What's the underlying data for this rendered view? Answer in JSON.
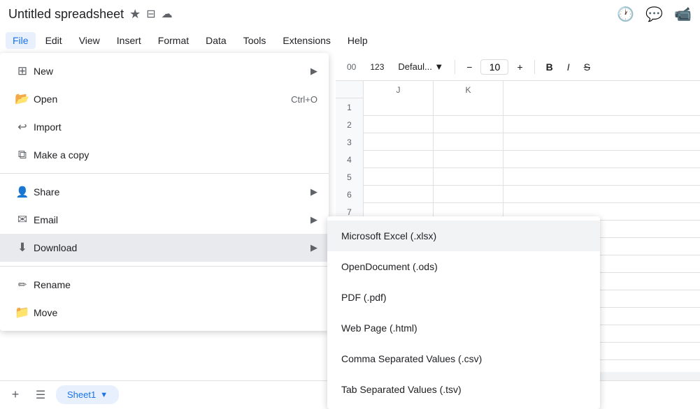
{
  "title": {
    "text": "Untitled spreadsheet",
    "star_icon": "★",
    "folder_icon": "📁",
    "cloud_icon": "☁"
  },
  "title_right_icons": {
    "history_icon": "🕐",
    "comment_icon": "💬",
    "video_icon": "📹"
  },
  "menu_bar": {
    "items": [
      {
        "label": "File",
        "active": true
      },
      {
        "label": "Edit"
      },
      {
        "label": "View"
      },
      {
        "label": "Insert"
      },
      {
        "label": "Format"
      },
      {
        "label": "Data"
      },
      {
        "label": "Tools"
      },
      {
        "label": "Extensions"
      },
      {
        "label": "Help"
      }
    ]
  },
  "toolbar": {
    "font_size": "10",
    "minus_label": "−",
    "plus_label": "+",
    "bold_label": "B",
    "italic_label": "I",
    "strikethrough_label": "S̶"
  },
  "file_menu": {
    "items": [
      {
        "id": "new",
        "icon": "＋",
        "label": "New",
        "arrow": true
      },
      {
        "id": "open",
        "icon": "📂",
        "label": "Open",
        "shortcut": "Ctrl+O"
      },
      {
        "id": "import",
        "icon": "↩",
        "label": "Import"
      },
      {
        "id": "make-copy",
        "icon": "📋",
        "label": "Make a copy"
      },
      {
        "divider": true
      },
      {
        "id": "share",
        "icon": "👤",
        "label": "Share",
        "arrow": true
      },
      {
        "id": "email",
        "icon": "✉",
        "label": "Email",
        "arrow": true
      },
      {
        "id": "download",
        "icon": "⬇",
        "label": "Download",
        "arrow": true,
        "highlighted": true
      },
      {
        "divider": true
      },
      {
        "id": "rename",
        "icon": "✏",
        "label": "Rename"
      },
      {
        "id": "move",
        "icon": "📁",
        "label": "Move"
      }
    ]
  },
  "download_submenu": {
    "items": [
      {
        "id": "xlsx",
        "label": "Microsoft Excel (.xlsx)"
      },
      {
        "id": "ods",
        "label": "OpenDocument (.ods)"
      },
      {
        "id": "pdf",
        "label": "PDF (.pdf)"
      },
      {
        "id": "html",
        "label": "Web Page (.html)"
      },
      {
        "id": "csv",
        "label": "Comma Separated Values (.csv)"
      },
      {
        "id": "tsv",
        "label": "Tab Separated Values (.tsv)"
      }
    ]
  },
  "grid": {
    "col_headers": [
      "J",
      "K"
    ],
    "rows": 15
  },
  "sheet_tabs": {
    "active": "Sheet1",
    "tabs": [
      {
        "label": "Sheet1",
        "active": true
      }
    ],
    "add_icon": "+",
    "menu_icon": "☰"
  },
  "scrollbar_label": ""
}
